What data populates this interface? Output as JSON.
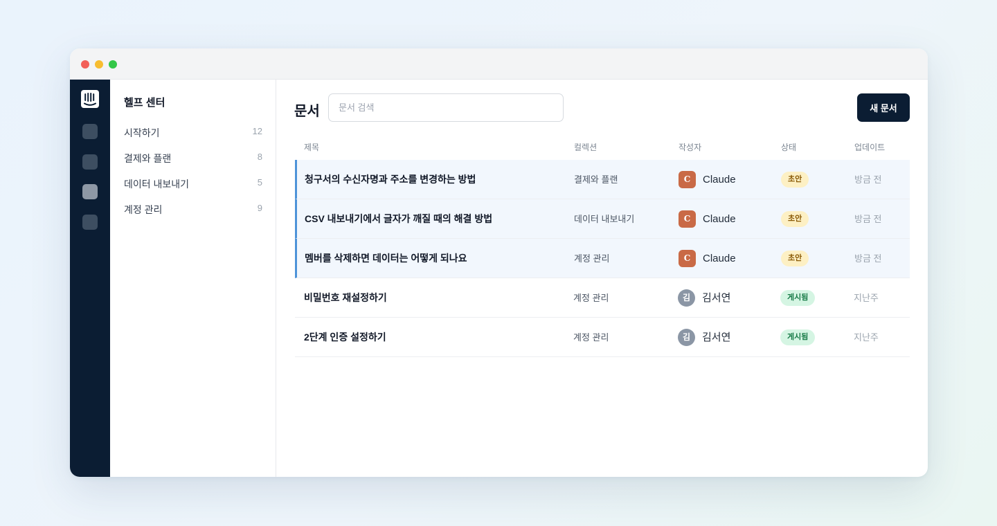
{
  "sidebar": {
    "title": "헬프 센터",
    "items": [
      {
        "label": "시작하기",
        "count": "12"
      },
      {
        "label": "결제와 플랜",
        "count": "8"
      },
      {
        "label": "데이터 내보내기",
        "count": "5"
      },
      {
        "label": "계정 관리",
        "count": "9"
      }
    ]
  },
  "main": {
    "title": "문서",
    "search_placeholder": "문서 검색",
    "new_button": "새 문서",
    "columns": {
      "title": "제목",
      "collection": "컬렉션",
      "author": "작성자",
      "status": "상태",
      "updated": "업데이트"
    },
    "rows": [
      {
        "title": "청구서의 수신자명과 주소를 변경하는 방법",
        "collection": "결제와 플랜",
        "avatar": "C",
        "author": "Claude",
        "status": "초안",
        "updated": "방금 전"
      },
      {
        "title": "CSV 내보내기에서 글자가 깨질 때의 해결 방법",
        "collection": "데이터 내보내기",
        "avatar": "C",
        "author": "Claude",
        "status": "초안",
        "updated": "방금 전"
      },
      {
        "title": "멤버를 삭제하면 데이터는 어떻게 되나요",
        "collection": "계정 관리",
        "avatar": "C",
        "author": "Claude",
        "status": "초안",
        "updated": "방금 전"
      },
      {
        "title": "비밀번호 재설정하기",
        "collection": "계정 관리",
        "avatar": "김",
        "author": "김서연",
        "status": "게시됨",
        "updated": "지난주"
      },
      {
        "title": "2단계 인증 설정하기",
        "collection": "계정 관리",
        "avatar": "김",
        "author": "김서연",
        "status": "게시됨",
        "updated": "지난주"
      }
    ]
  },
  "colors": {
    "rail_bg": "#0b1d33",
    "accent_border": "#4d93d9",
    "claude_avatar": "#c96a46",
    "draft_badge": "#fdf0c4",
    "published_badge": "#d5f5e3"
  },
  "icons": {
    "logo": "intercom-logo-icon"
  }
}
